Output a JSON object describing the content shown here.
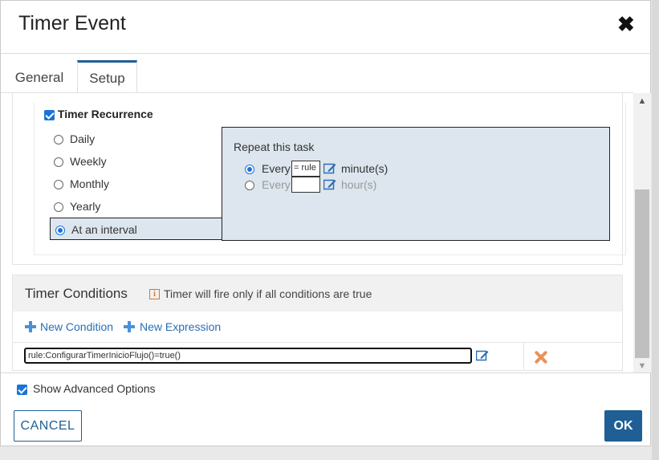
{
  "dialog": {
    "title": "Timer Event",
    "close_symbol": "✖"
  },
  "tabs": [
    {
      "label": "General",
      "active": false
    },
    {
      "label": "Setup",
      "active": true
    }
  ],
  "recurrence": {
    "checkbox_label": "Timer Recurrence",
    "checked": true,
    "options": [
      {
        "label": "Daily",
        "selected": false
      },
      {
        "label": "Weekly",
        "selected": false
      },
      {
        "label": "Monthly",
        "selected": false
      },
      {
        "label": "Yearly",
        "selected": false
      },
      {
        "label": "At an interval",
        "selected": true
      }
    ]
  },
  "repeat": {
    "title": "Repeat this task",
    "rows": [
      {
        "label": "Every",
        "value": "= rule",
        "unit": "minute(s)",
        "selected": true,
        "edit_icon": "edit-icon"
      },
      {
        "label": "Every",
        "value": "",
        "unit": "hour(s)",
        "selected": false,
        "edit_icon": "edit-icon"
      }
    ]
  },
  "conditions": {
    "title": "Timer Conditions",
    "info_icon": "info-icon",
    "info_text": "Timer will fire only if all conditions are true",
    "new_condition": "New Condition",
    "new_expression": "New Expression",
    "row_value": "rule:ConfigurarTimerInicioFlujo()=true()",
    "delete_icon": "delete-icon"
  },
  "advanced": {
    "label": "Show Advanced Options",
    "checked": true
  },
  "buttons": {
    "cancel": "CANCEL",
    "ok": "OK"
  },
  "colors": {
    "primary": "#1f5f95",
    "checkbox": "#1a73d9",
    "popup_bg": "#dde6ee",
    "link": "#2a6db5",
    "delete": "#e8925a"
  }
}
